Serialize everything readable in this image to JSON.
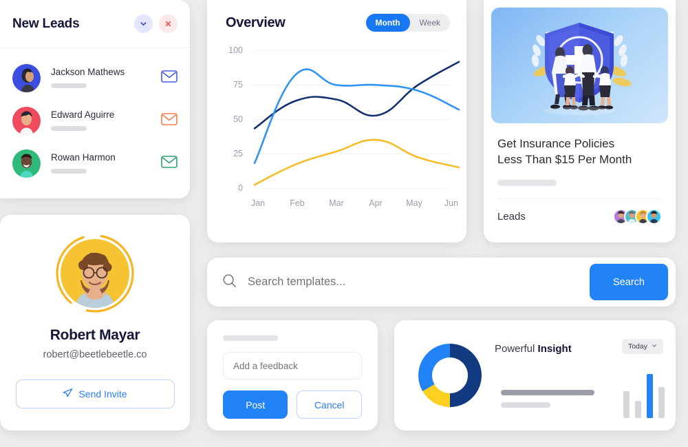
{
  "leads_panel": {
    "title": "New Leads",
    "collapse_icon": "chevron-down-icon",
    "close_icon": "close-icon",
    "items": [
      {
        "name": "Jackson Mathews",
        "avatar_color": "#3b4ee0",
        "mail_icon_color": "#4a5ae8"
      },
      {
        "name": "Edward Aguirre",
        "avatar_color": "#f04a5e",
        "mail_icon_color": "#f47a50"
      },
      {
        "name": "Rowan Harmon",
        "avatar_color": "#2fb97a",
        "mail_icon_color": "#2fa06e"
      }
    ]
  },
  "profile": {
    "name": "Robert Mayar",
    "email": "robert@beetlebeetle.co",
    "invite_label": "Send Invite",
    "invite_icon": "send-plane-icon",
    "ring_color": "#f6b422",
    "avatar_bg": "#f6c433"
  },
  "overview": {
    "title": "Overview",
    "range_options": [
      "Month",
      "Week"
    ],
    "range_selected": "Month"
  },
  "chart_data": {
    "type": "line",
    "title": "Overview",
    "xlabel": "",
    "ylabel": "",
    "categories": [
      "Jan",
      "Feb",
      "Mar",
      "Apr",
      "May",
      "Jun"
    ],
    "ylim": [
      0,
      100
    ],
    "yticks": [
      0,
      25,
      50,
      75,
      100
    ],
    "grid": true,
    "legend": "none",
    "series": [
      {
        "name": "Navy",
        "color": "#12306e",
        "values": [
          46,
          65,
          66,
          55,
          76,
          92
        ]
      },
      {
        "name": "Blue",
        "color": "#2f93f5",
        "values": [
          22,
          83,
          76,
          76,
          72,
          59
        ]
      },
      {
        "name": "Yellow",
        "color": "#f6bd2b",
        "values": [
          7,
          21,
          30,
          38,
          26,
          19
        ]
      }
    ]
  },
  "insurance": {
    "illustration": "family-shield-insurance-illustration",
    "headline": "Get Insurance Policies\nLess Than $15 Per Month",
    "headline_line1": "Get Insurance Policies",
    "headline_line2": "Less Than $15 Per Month",
    "footer_label": "Leads",
    "avatar_colors": [
      "#b57ae0",
      "#4fc0c7",
      "#f6c433",
      "#35c3ef"
    ]
  },
  "search": {
    "icon": "search-icon",
    "placeholder": "Search templates...",
    "value": "",
    "button_label": "Search",
    "button_color": "#2283f6"
  },
  "feedback": {
    "input_placeholder": "Add a feedback",
    "input_value": "",
    "post_label": "Post",
    "cancel_label": "Cancel"
  },
  "insight": {
    "title_normal": "Powerful ",
    "title_bold": "Insight",
    "range_label": "Today",
    "range_icon": "chevron-down-icon",
    "donut": {
      "type": "pie",
      "segments": [
        {
          "name": "Navy",
          "value": 50,
          "color": "#123a80"
        },
        {
          "name": "Blue",
          "value": 34,
          "color": "#2283f6"
        },
        {
          "name": "Yellow",
          "value": 16,
          "color": "#fcd020"
        }
      ]
    },
    "minibars": {
      "type": "bar",
      "values": [
        38,
        24,
        62,
        44
      ],
      "colors": [
        "#d6d6db",
        "#d6d6db",
        "#2283f6",
        "#d6d6db"
      ]
    }
  }
}
